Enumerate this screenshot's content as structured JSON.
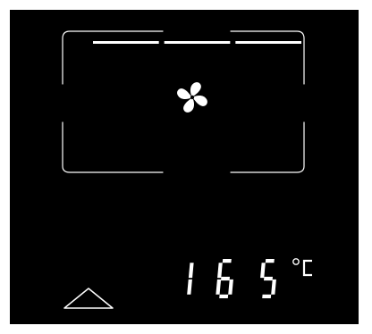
{
  "display": {
    "temperature": {
      "digits": [
        "1",
        "6",
        "5"
      ],
      "unit": "°C"
    },
    "mode_icon": "fan-icon",
    "level_bars": {
      "segments": 3,
      "lit": 3
    },
    "controls": {
      "up_icon": "chevron-up-icon"
    },
    "colors": {
      "background": "#000000",
      "segment": "#ffffff"
    }
  }
}
